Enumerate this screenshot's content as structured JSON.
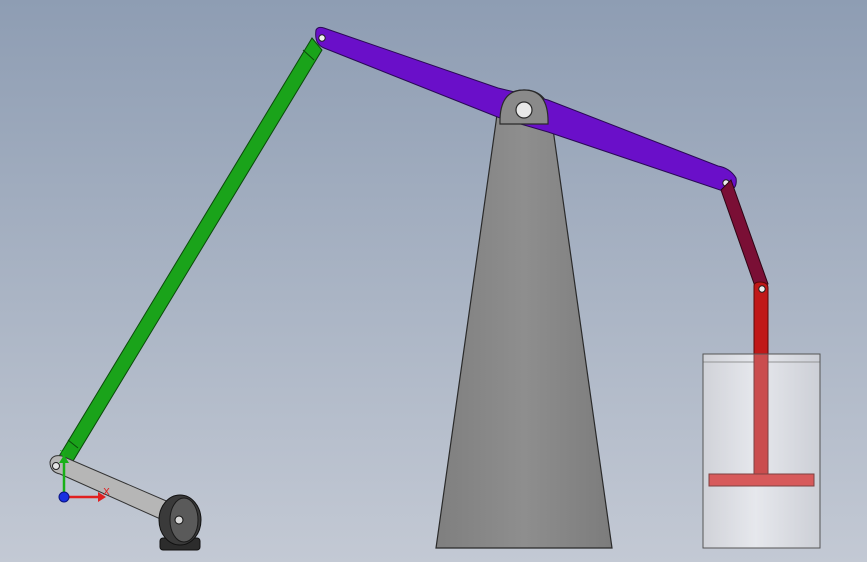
{
  "viewport": {
    "background_top": "#8e9db3",
    "background_bottom": "#c3c9d4"
  },
  "parts": {
    "crank": {
      "color": "#b6b6b6"
    },
    "connecting_rod": {
      "color": "#1aa31a"
    },
    "walking_beam": {
      "color": "#6a0fc9"
    },
    "support_pillar": {
      "color": "#8a8a8a"
    },
    "link_rod": {
      "color": "#7a0f35"
    },
    "piston_rod": {
      "color": "#c01818"
    },
    "cylinder": {
      "color": "#dcdde2"
    },
    "wheel": {
      "color": "#3a3a3a"
    }
  },
  "triad": {
    "x_label": "X",
    "y_label": "Y",
    "x_color": "#e02020",
    "y_color": "#18b018",
    "z_color": "#1830e0"
  }
}
